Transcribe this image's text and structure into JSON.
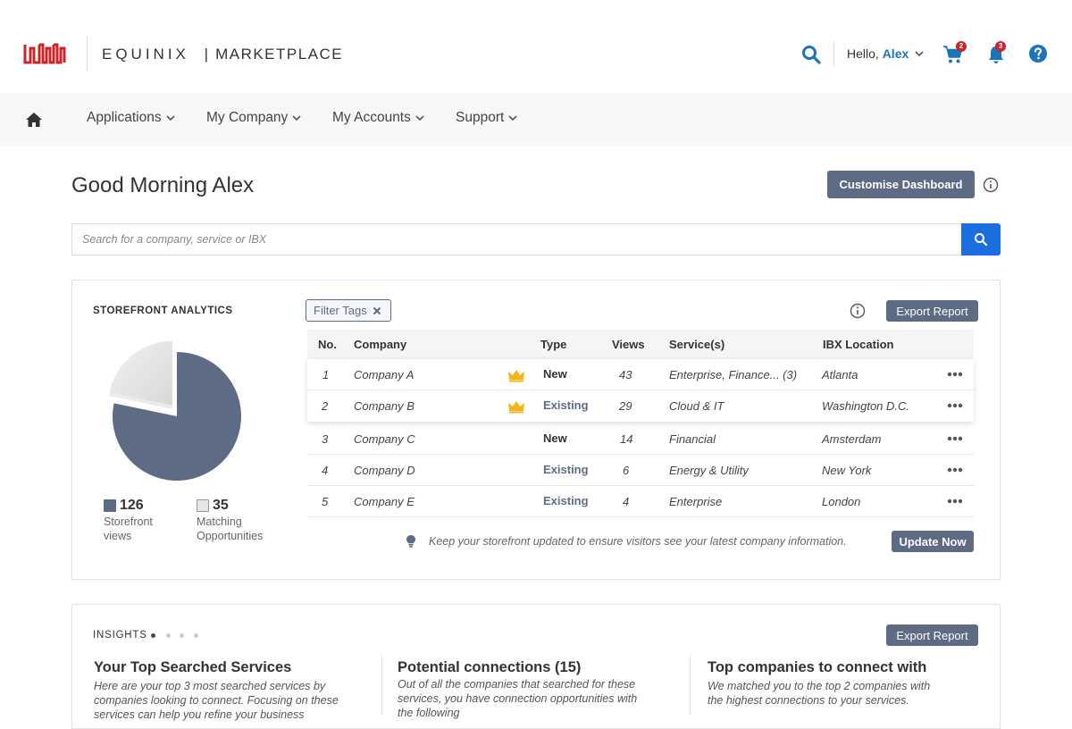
{
  "header": {
    "brand_left": "EQUINIX",
    "brand_sep": "|",
    "brand_right": "MARKETPLACE",
    "hello_prefix": "Hello,",
    "user_name": "Alex",
    "cart_count": "2",
    "notif_count": "3",
    "accent_color": "#1b75bb",
    "logo_color": "#c8262a"
  },
  "nav": {
    "items": [
      {
        "label": "Applications"
      },
      {
        "label": "My Company"
      },
      {
        "label": "My Accounts"
      },
      {
        "label": "Support"
      }
    ]
  },
  "dashboard": {
    "greeting": "Good Morning Alex",
    "customise_label": "Customise Dashboard",
    "search_placeholder": "Search for a company, service or IBX"
  },
  "storefront": {
    "title": "STOREFRONT ANALYTICS",
    "filter_label": "Filter Tags",
    "export_label": "Export Report",
    "pie": {
      "storefront_views": 126,
      "matching_opportunities": 35,
      "views_color": "#5e6b85",
      "matching_color": "#e6e6e6"
    },
    "stats": {
      "views_num": "126",
      "views_label_1": "Storefront",
      "views_label_2": "views",
      "match_num": "35",
      "match_label_1": "Matching",
      "match_label_2": "Opportunities"
    },
    "columns": {
      "no": "No.",
      "company": "Company",
      "type": "Type",
      "views": "Views",
      "services": "Service(s)",
      "ibx": "IBX Location"
    },
    "rows": [
      {
        "no": "1",
        "company": "Company A",
        "crown": true,
        "type": "New",
        "views": "43",
        "services": "Enterprise, Finance... (3)",
        "ibx": "Atlanta"
      },
      {
        "no": "2",
        "company": "Company B",
        "crown": true,
        "type": "Existing",
        "views": "29",
        "services": "Cloud & IT",
        "ibx": "Washington D.C."
      },
      {
        "no": "3",
        "company": "Company C",
        "crown": false,
        "type": "New",
        "views": "14",
        "services": "Financial",
        "ibx": "Amsterdam"
      },
      {
        "no": "4",
        "company": "Company D",
        "crown": false,
        "type": "Existing",
        "views": "6",
        "services": "Energy & Utility",
        "ibx": "New York"
      },
      {
        "no": "5",
        "company": "Company E",
        "crown": false,
        "type": "Existing",
        "views": "4",
        "services": "Enterprise",
        "ibx": "London"
      }
    ],
    "tip": "Keep your storefront updated to ensure visitors see your latest company information.",
    "update_label": "Update Now"
  },
  "insights": {
    "title": "INSIGHTS",
    "export_label": "Export Report",
    "columns": [
      {
        "title": "Your Top Searched Services",
        "line1": "Here are your top 3 most searched services by",
        "line2": "companies looking to connect. Focusing on these",
        "line3": "services can help you refine your business"
      },
      {
        "title": "Potential connections (15)",
        "line1": "Out of all the companies that searched for these",
        "line2": "services, you have connection opportunities with",
        "line3": "the following"
      },
      {
        "title": "Top companies to connect with",
        "line1": "We matched you to the top 2 companies with",
        "line2": "the highest connections to your services.",
        "line3": ""
      }
    ]
  }
}
